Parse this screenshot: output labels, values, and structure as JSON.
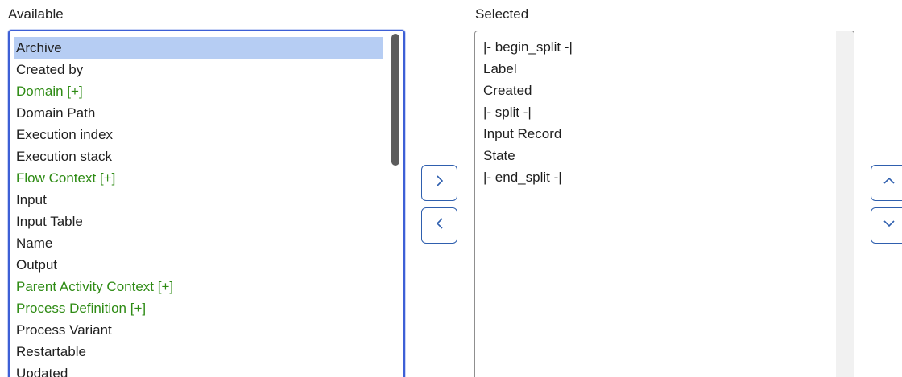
{
  "available": {
    "heading": "Available",
    "items": [
      {
        "label": "Archive",
        "expandable": false,
        "selected": true
      },
      {
        "label": "Created by",
        "expandable": false,
        "selected": false
      },
      {
        "label": "Domain [+]",
        "expandable": true,
        "selected": false
      },
      {
        "label": "Domain Path",
        "expandable": false,
        "selected": false
      },
      {
        "label": "Execution index",
        "expandable": false,
        "selected": false
      },
      {
        "label": "Execution stack",
        "expandable": false,
        "selected": false
      },
      {
        "label": "Flow Context [+]",
        "expandable": true,
        "selected": false
      },
      {
        "label": "Input",
        "expandable": false,
        "selected": false
      },
      {
        "label": "Input Table",
        "expandable": false,
        "selected": false
      },
      {
        "label": "Name",
        "expandable": false,
        "selected": false
      },
      {
        "label": "Output",
        "expandable": false,
        "selected": false
      },
      {
        "label": "Parent Activity Context [+]",
        "expandable": true,
        "selected": false
      },
      {
        "label": "Process Definition [+]",
        "expandable": true,
        "selected": false
      },
      {
        "label": "Process Variant",
        "expandable": false,
        "selected": false
      },
      {
        "label": "Restartable",
        "expandable": false,
        "selected": false
      },
      {
        "label": "Updated",
        "expandable": false,
        "selected": false
      }
    ]
  },
  "selected": {
    "heading": "Selected",
    "items": [
      "|- begin_split -|",
      "Label",
      "Created",
      "|- split -|",
      "Input Record",
      "State",
      "|- end_split -|"
    ]
  },
  "buttons": {
    "add_icon": "chevron-right-icon",
    "remove_icon": "chevron-left-icon",
    "move_up_icon": "chevron-up-icon",
    "move_down_icon": "chevron-down-icon"
  },
  "colors": {
    "expandable_text": "#2e8b14",
    "selected_row_bg": "#b6cdf3",
    "focus_border": "#3d5fd6",
    "button_border": "#2f5fae"
  }
}
